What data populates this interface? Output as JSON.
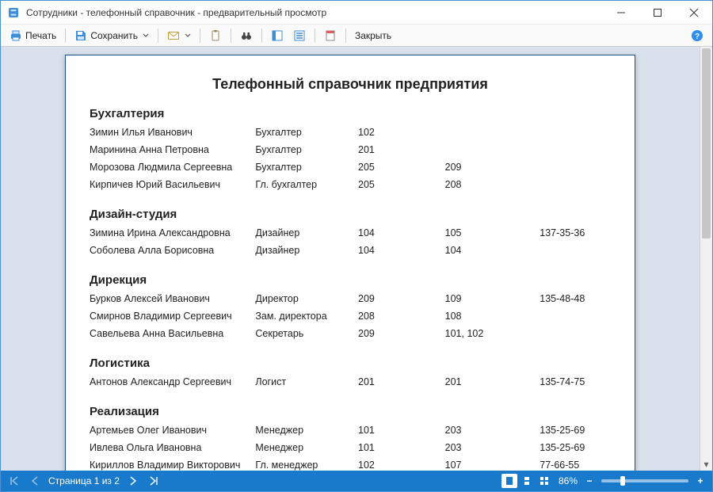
{
  "window": {
    "title": "Сотрудники - телефонный справочник - предварительный просмотр"
  },
  "toolbar": {
    "print_label": "Печать",
    "save_label": "Сохранить",
    "close_label": "Закрыть"
  },
  "report": {
    "title": "Телефонный справочник предприятия",
    "groups": [
      {
        "name": "Бухгалтерия",
        "rows": [
          {
            "name": "Зимин Илья Иванович",
            "position": "Бухгалтер",
            "p1": "102",
            "p2": "",
            "ext": ""
          },
          {
            "name": "Маринина Анна Петровна",
            "position": "Бухгалтер",
            "p1": "201",
            "p2": "",
            "ext": ""
          },
          {
            "name": "Морозова Людмила Сергеевна",
            "position": "Бухгалтер",
            "p1": "205",
            "p2": "209",
            "ext": ""
          },
          {
            "name": "Кирпичев Юрий Васильевич",
            "position": "Гл. бухгалтер",
            "p1": "205",
            "p2": "208",
            "ext": ""
          }
        ]
      },
      {
        "name": "Дизайн-студия",
        "rows": [
          {
            "name": "Зимина Ирина Александровна",
            "position": "Дизайнер",
            "p1": "104",
            "p2": "105",
            "ext": "137-35-36"
          },
          {
            "name": "Соболева Алла Борисовна",
            "position": "Дизайнер",
            "p1": "104",
            "p2": "104",
            "ext": ""
          }
        ]
      },
      {
        "name": "Дирекция",
        "rows": [
          {
            "name": "Бурков Алексей Иванович",
            "position": "Директор",
            "p1": "209",
            "p2": "109",
            "ext": "135-48-48"
          },
          {
            "name": "Смирнов Владимир Сергеевич",
            "position": "Зам. директора",
            "p1": "208",
            "p2": "108",
            "ext": ""
          },
          {
            "name": "Савельева Анна Васильевна",
            "position": "Секретарь",
            "p1": "209",
            "p2": "101, 102",
            "ext": ""
          }
        ]
      },
      {
        "name": "Логистика",
        "rows": [
          {
            "name": "Антонов Александр Сергеевич",
            "position": "Логист",
            "p1": "201",
            "p2": "201",
            "ext": "135-74-75"
          }
        ]
      },
      {
        "name": "Реализация",
        "rows": [
          {
            "name": "Артемьев Олег Иванович",
            "position": "Менеджер",
            "p1": "101",
            "p2": "203",
            "ext": "135-25-69"
          },
          {
            "name": "Ивлева Ольга Ивановна",
            "position": "Менеджер",
            "p1": "101",
            "p2": "203",
            "ext": "135-25-69"
          },
          {
            "name": "Кириллов Владимир Викторович",
            "position": "Гл. менеджер",
            "p1": "102",
            "p2": "107",
            "ext": "77-66-55"
          }
        ]
      }
    ]
  },
  "footer": {
    "page_label": "Страница 1 из 2",
    "zoom_label": "86%"
  }
}
